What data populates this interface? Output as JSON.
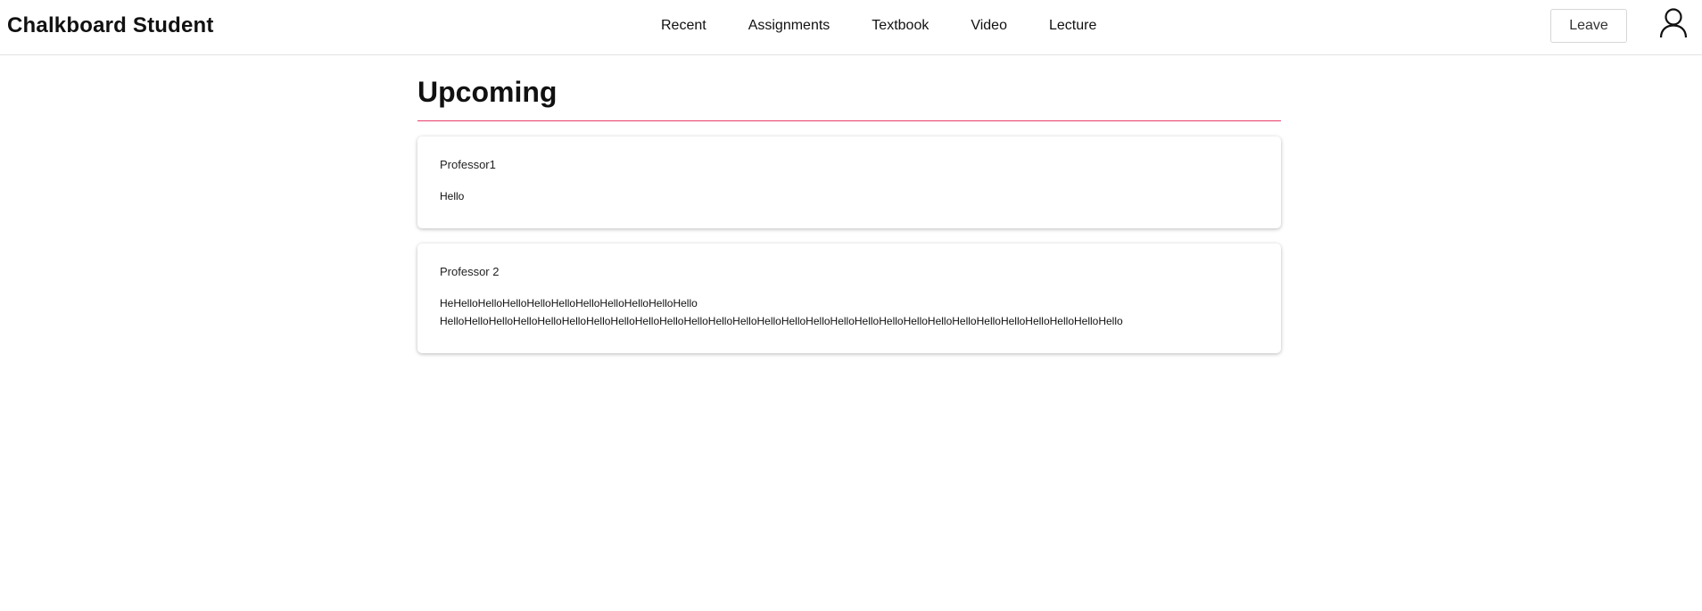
{
  "header": {
    "app_title": "Chalkboard Student",
    "nav": [
      {
        "label": "Recent"
      },
      {
        "label": "Assignments"
      },
      {
        "label": "Textbook"
      },
      {
        "label": "Video"
      },
      {
        "label": "Lecture"
      }
    ],
    "leave_label": "Leave",
    "user_icon": "user-icon"
  },
  "main": {
    "title": "Upcoming",
    "accent_color": "#e83e6c",
    "posts": [
      {
        "author": "Professor1",
        "lines": [
          "Hello"
        ]
      },
      {
        "author": "Professor 2",
        "lines": [
          "HeHelloHelloHelloHelloHelloHelloHelloHelloHelloHello",
          "HelloHelloHelloHelloHelloHelloHelloHelloHelloHelloHelloHelloHelloHelloHelloHelloHelloHelloHelloHelloHelloHelloHelloHelloHelloHelloHelloHello"
        ]
      }
    ]
  }
}
